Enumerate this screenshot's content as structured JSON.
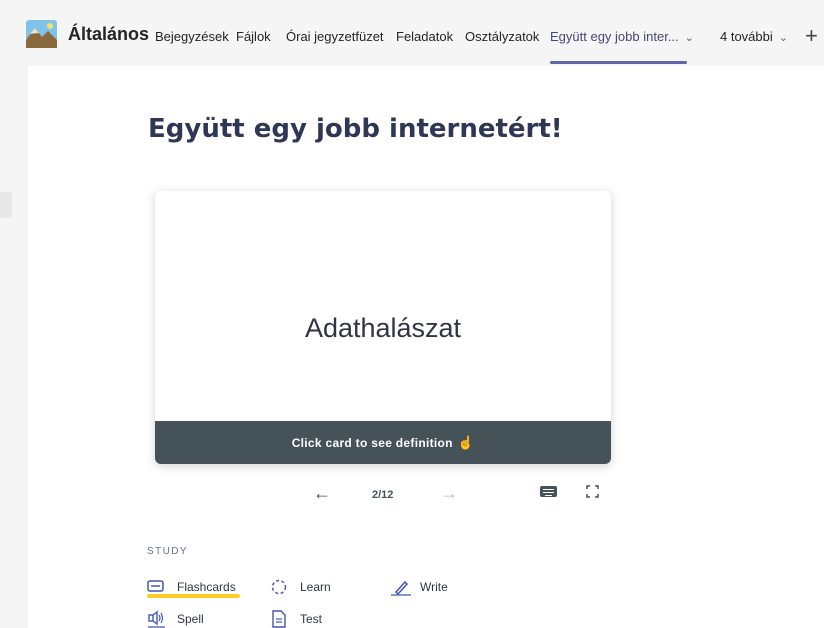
{
  "header": {
    "channel_name": "Általános",
    "tabs": [
      {
        "label": "Bejegyzések"
      },
      {
        "label": "Fájlok"
      },
      {
        "label": "Órai jegyzetfüzet"
      },
      {
        "label": "Feladatok"
      },
      {
        "label": "Osztályzatok"
      },
      {
        "label": "Együtt egy jobb inter..."
      },
      {
        "label": "4 további"
      }
    ],
    "active_tab": "Együtt egy jobb inter...",
    "accent_color": "#6264a7"
  },
  "set": {
    "title": "Együtt egy jobb internetért!"
  },
  "card": {
    "term": "Adathalászat",
    "footer_hint": "Click card to see definition"
  },
  "controls": {
    "counter": "2/12",
    "prev_icon": "arrow-left-icon",
    "next_icon": "arrow-right-icon",
    "keyboard_icon": "keyboard-icon",
    "fullscreen_icon": "fullscreen-icon"
  },
  "study": {
    "label": "STUDY",
    "modes": [
      {
        "label": "Flashcards",
        "icon": "flashcards-icon"
      },
      {
        "label": "Learn",
        "icon": "learn-icon"
      },
      {
        "label": "Write",
        "icon": "write-icon"
      },
      {
        "label": "Spell",
        "icon": "spell-icon"
      },
      {
        "label": "Test",
        "icon": "test-icon"
      }
    ],
    "highlight_color": "#ffcd1f"
  }
}
